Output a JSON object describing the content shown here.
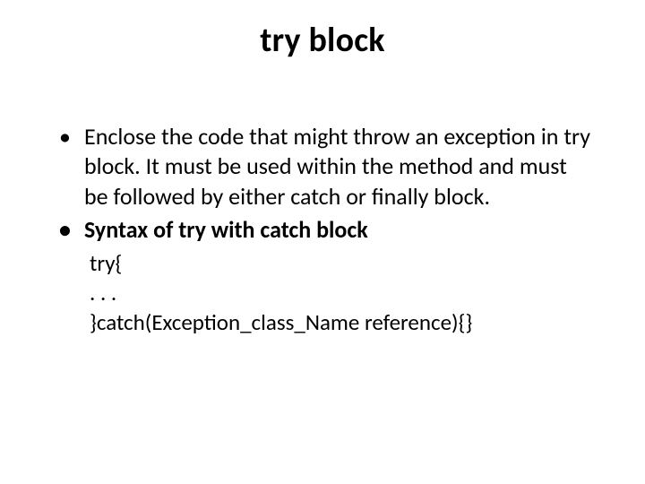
{
  "slide": {
    "title": "try block",
    "bullets": [
      {
        "text": "Enclose the code that might throw an exception in try block. It must be used within the method and must be followed by either catch or finally block.",
        "bold": false
      },
      {
        "text": "Syntax of try with catch block",
        "bold": true
      }
    ],
    "code_lines": [
      "try{",
      ". . .",
      "}catch(Exception_class_Name reference){}"
    ]
  }
}
